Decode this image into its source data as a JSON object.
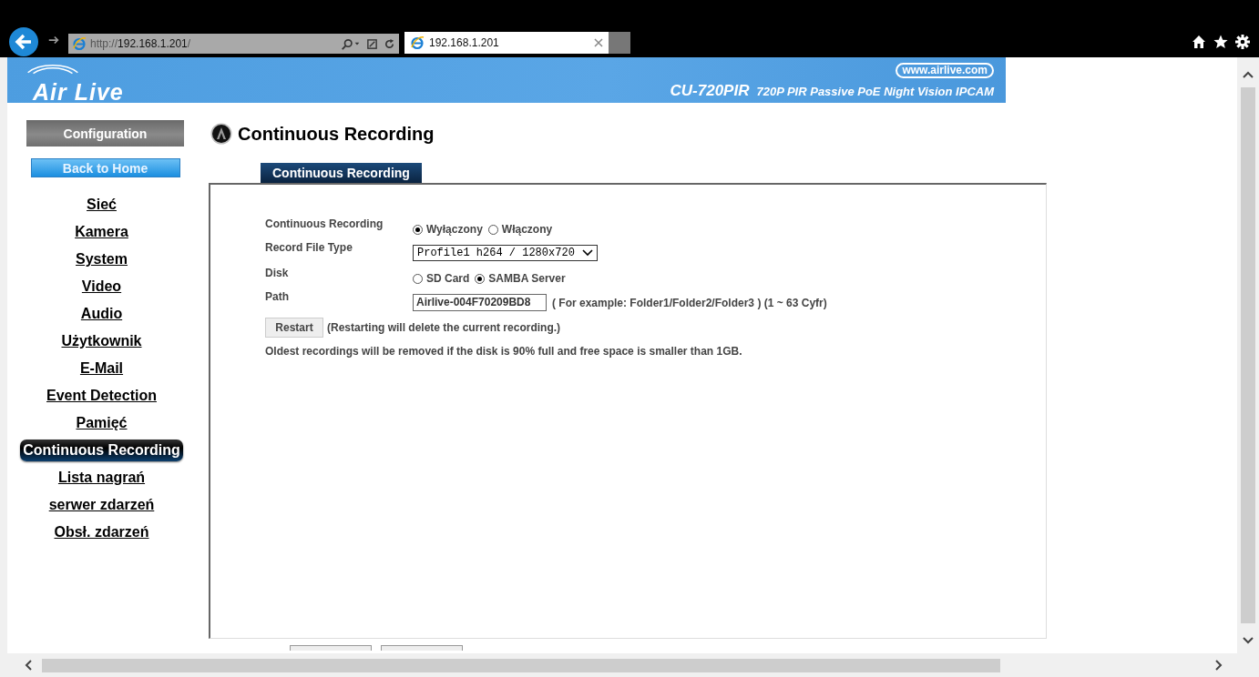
{
  "browser": {
    "address": {
      "scheme": "http://",
      "host": "192.168.1.201",
      "path": "/"
    },
    "tab_title": "192.168.1.201"
  },
  "banner": {
    "logo": "Air Live",
    "url": "www.airlive.com",
    "model": "CU-720PIR",
    "description": "720P PIR Passive PoE Night Vision IPCAM"
  },
  "sidebar": {
    "config_button": "Configuration",
    "home_button": "Back to Home",
    "items": [
      {
        "label": "Sieć",
        "selected": false
      },
      {
        "label": "Kamera",
        "selected": false
      },
      {
        "label": "System",
        "selected": false
      },
      {
        "label": "Video",
        "selected": false
      },
      {
        "label": "Audio",
        "selected": false
      },
      {
        "label": "Użytkownik",
        "selected": false
      },
      {
        "label": "E-Mail",
        "selected": false
      },
      {
        "label": "Event Detection",
        "selected": false
      },
      {
        "label": "Pamięć",
        "selected": false
      },
      {
        "label": "Continuous Recording",
        "selected": true
      },
      {
        "label": "Lista nagrań",
        "selected": false
      },
      {
        "label": "serwer zdarzeń",
        "selected": false
      },
      {
        "label": "Obsł. zdarzeń",
        "selected": false
      }
    ]
  },
  "page": {
    "title": "Continuous Recording",
    "tabs": [
      {
        "label": "Continuous Recording",
        "selected": true
      }
    ],
    "rows": [
      {
        "kind": "radio",
        "label": "Continuous Recording",
        "options": [
          {
            "label": "Wyłączony",
            "selected": true
          },
          {
            "label": "Włączony",
            "selected": false
          }
        ]
      },
      {
        "kind": "select",
        "label": "Record File Type",
        "value": "Profile1 h264 / 1280x720"
      },
      {
        "kind": "radio",
        "label": "Disk",
        "options": [
          {
            "label": "SD Card",
            "selected": false
          },
          {
            "label": "SAMBA Server",
            "selected": true
          }
        ]
      },
      {
        "kind": "text",
        "label": "Path",
        "value": "Airlive-004F70209BD8",
        "hint": "( For example: Folder1/Folder2/Folder3 ) (1 ~ 63 Cyfr)"
      }
    ],
    "restart": {
      "button": "Restart",
      "note": "(Restarting will delete the current recording.)"
    },
    "footnote": "Oldest recordings will be removed if the disk is 90% full and free space is smaller than 1GB."
  }
}
